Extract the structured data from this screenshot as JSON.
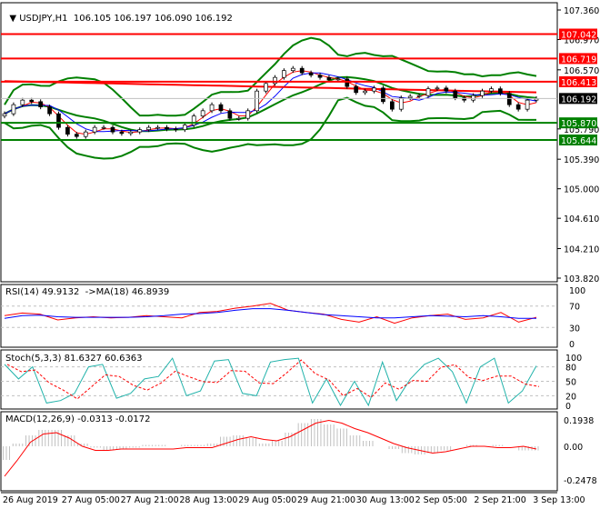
{
  "header": {
    "symbol_timeframe": "USDJPY,H1",
    "ohlc": "106.105 106.197 106.090 106.192"
  },
  "colors": {
    "resistance": "#ff0000",
    "support": "#008000",
    "current": "#000000",
    "bands": "#008000",
    "rsi": "#ff0000",
    "rsi_ma": "#0000ff",
    "stoch_k": "#20b2aa",
    "stoch_d": "#ff0000",
    "macd_hist": "#c0c0c0",
    "macd_signal": "#ff0000"
  },
  "chart_data": [
    {
      "type": "line",
      "title": "USDJPY,H1",
      "ylim": [
        103.82,
        107.36
      ],
      "y_ticks": [
        "107.360",
        "106.970",
        "106.570",
        "105.790",
        "105.390",
        "105.000",
        "104.610",
        "104.210",
        "103.820"
      ],
      "x_ticks": [
        "26 Aug 2019",
        "27 Aug 05:00",
        "27 Aug 21:00",
        "28 Aug 13:00",
        "29 Aug 05:00",
        "29 Aug 21:00",
        "30 Aug 13:00",
        "2 Sep 05:00",
        "2 Sep 21:00",
        "3 Sep 13:00"
      ],
      "levels": [
        {
          "label": "107.042",
          "value": 107.042,
          "kind": "resistance"
        },
        {
          "label": "106.719",
          "value": 106.719,
          "kind": "resistance"
        },
        {
          "label": "106.413",
          "value": 106.413,
          "kind": "resistance"
        },
        {
          "label": "106.192",
          "value": 106.192,
          "kind": "current"
        },
        {
          "label": "105.870",
          "value": 105.87,
          "kind": "support"
        },
        {
          "label": "105.644",
          "value": 105.644,
          "kind": "support"
        }
      ],
      "close": [
        105.99,
        106.11,
        106.17,
        106.15,
        106.08,
        105.99,
        105.81,
        105.72,
        105.69,
        105.75,
        105.81,
        105.81,
        105.75,
        105.73,
        105.75,
        105.78,
        105.81,
        105.81,
        105.79,
        105.78,
        105.84,
        105.96,
        106.03,
        106.11,
        106.03,
        105.93,
        105.93,
        106.03,
        106.29,
        106.39,
        106.47,
        106.56,
        106.59,
        106.53,
        106.5,
        106.47,
        106.44,
        106.45,
        106.35,
        106.27,
        106.29,
        106.33,
        106.15,
        106.05,
        106.2,
        106.22,
        106.23,
        106.32,
        106.33,
        106.29,
        106.2,
        106.17,
        106.23,
        106.29,
        106.32,
        106.26,
        106.11,
        106.05,
        106.17,
        106.19
      ]
    },
    {
      "type": "line",
      "title": "RSI(14) 49.9132  ->MA(18) 46.8939",
      "ylim": [
        0,
        100
      ],
      "y_ticks": [
        "100",
        "70",
        "30",
        "0"
      ],
      "levels": [
        70,
        30
      ],
      "rsi": [
        52,
        57,
        55,
        44,
        48,
        50,
        48,
        49,
        52,
        50,
        48,
        58,
        60,
        66,
        70,
        75,
        62,
        58,
        55,
        45,
        40,
        50,
        38,
        48,
        52,
        55,
        45,
        48,
        58,
        40,
        49
      ],
      "ma": [
        47,
        52,
        53,
        50,
        49,
        49,
        49,
        49,
        50,
        52,
        55,
        56,
        58,
        62,
        65,
        65,
        62,
        58,
        54,
        52,
        50,
        48,
        48,
        50,
        52,
        51,
        50,
        52,
        50,
        47,
        47
      ]
    },
    {
      "type": "line",
      "title": "Stoch(5,3,3) 81.6327 60.6363",
      "ylim": [
        0,
        100
      ],
      "y_ticks": [
        "100",
        "80",
        "50",
        "20",
        "0"
      ],
      "levels": [
        80,
        50,
        20
      ],
      "k": [
        85,
        55,
        80,
        5,
        10,
        25,
        80,
        85,
        15,
        25,
        55,
        60,
        98,
        20,
        30,
        92,
        95,
        25,
        20,
        90,
        95,
        98,
        5,
        55,
        0,
        50,
        0,
        90,
        10,
        55,
        85,
        98,
        70,
        5,
        80,
        98,
        5,
        30,
        82
      ]
    },
    {
      "type": "bar",
      "title": "MACD(12,26,9) -0.0313 -0.0172",
      "ylim": [
        -0.2478,
        0.1938
      ],
      "y_ticks": [
        "0.1938",
        "0.00",
        "-0.2478"
      ],
      "histogram": [
        -0.1,
        0.02,
        0.08,
        0.12,
        0.12,
        0.08,
        0.02,
        -0.01,
        -0.03,
        -0.02,
        -0.01,
        0.01,
        0.01,
        0.0,
        0.01,
        0.01,
        0.02,
        0.07,
        0.08,
        0.06,
        0.02,
        0.04,
        0.1,
        0.17,
        0.2,
        0.16,
        0.13,
        0.08,
        0.04,
        0.0,
        -0.02,
        -0.05,
        -0.06,
        -0.05,
        -0.03,
        0.0,
        0.01,
        0.0,
        0.01,
        0.0,
        -0.03,
        -0.03
      ],
      "signal": [
        -0.22,
        -0.1,
        0.03,
        0.09,
        0.1,
        0.06,
        0.0,
        -0.03,
        -0.03,
        -0.02,
        -0.02,
        -0.02,
        -0.02,
        -0.02,
        -0.01,
        -0.01,
        -0.01,
        0.02,
        0.05,
        0.07,
        0.05,
        0.04,
        0.07,
        0.12,
        0.17,
        0.19,
        0.17,
        0.13,
        0.1,
        0.06,
        0.02,
        -0.01,
        -0.03,
        -0.05,
        -0.04,
        -0.02,
        0.0,
        0.0,
        -0.01,
        -0.01,
        0.0,
        -0.02
      ]
    }
  ]
}
